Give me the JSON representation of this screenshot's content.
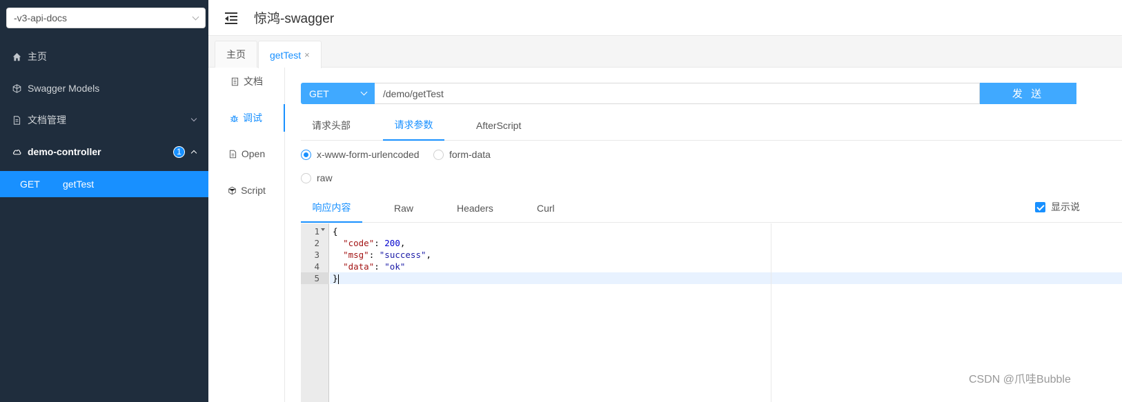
{
  "sidebar": {
    "group_select": "-v3-api-docs",
    "items": [
      {
        "label": "主页",
        "icon": "home-icon"
      },
      {
        "label": "Swagger Models",
        "icon": "cube-icon"
      },
      {
        "label": "文档管理",
        "icon": "file-icon"
      },
      {
        "label": "demo-controller",
        "icon": "cloud-icon",
        "badge": "1"
      }
    ],
    "subitem": {
      "method": "GET",
      "label": "getTest"
    }
  },
  "header": {
    "title": "惊鸿-swagger"
  },
  "tabs": [
    {
      "label": "主页"
    },
    {
      "label": "getTest",
      "close": "×"
    }
  ],
  "vtabs": [
    {
      "label": "文档",
      "icon": "doc-icon"
    },
    {
      "label": "调试",
      "icon": "bug-icon"
    },
    {
      "label": "Open",
      "icon": "file-icon"
    },
    {
      "label": "Script",
      "icon": "script-icon"
    }
  ],
  "request": {
    "method": "GET",
    "url": "/demo/getTest",
    "send_label": "发 送"
  },
  "subtabs": [
    {
      "label": "请求头部"
    },
    {
      "label": "请求参数"
    },
    {
      "label": "AfterScript"
    }
  ],
  "radios": [
    {
      "label": "x-www-form-urlencoded",
      "checked": true
    },
    {
      "label": "form-data",
      "checked": false
    },
    {
      "label": "raw",
      "checked": false
    }
  ],
  "resptabs": [
    {
      "label": "响应内容"
    },
    {
      "label": "Raw"
    },
    {
      "label": "Headers"
    },
    {
      "label": "Curl"
    }
  ],
  "show_desc_label": "显示说",
  "editor": {
    "line_numbers": [
      "1",
      "2",
      "3",
      "4",
      "5"
    ],
    "lines": {
      "l1": "{",
      "l2_key": "\"code\"",
      "l2_sep": ": ",
      "l2_val": "200",
      "l2_end": ",",
      "l3_key": "\"msg\"",
      "l3_sep": ": ",
      "l3_val": "\"success\"",
      "l3_end": ",",
      "l4_key": "\"data\"",
      "l4_sep": ": ",
      "l4_val": "\"ok\"",
      "l5": "}"
    }
  },
  "watermark": "CSDN @爪哇Bubble",
  "colors": {
    "accent": "#1890ff",
    "sidebar_bg": "#1f2d3d"
  }
}
